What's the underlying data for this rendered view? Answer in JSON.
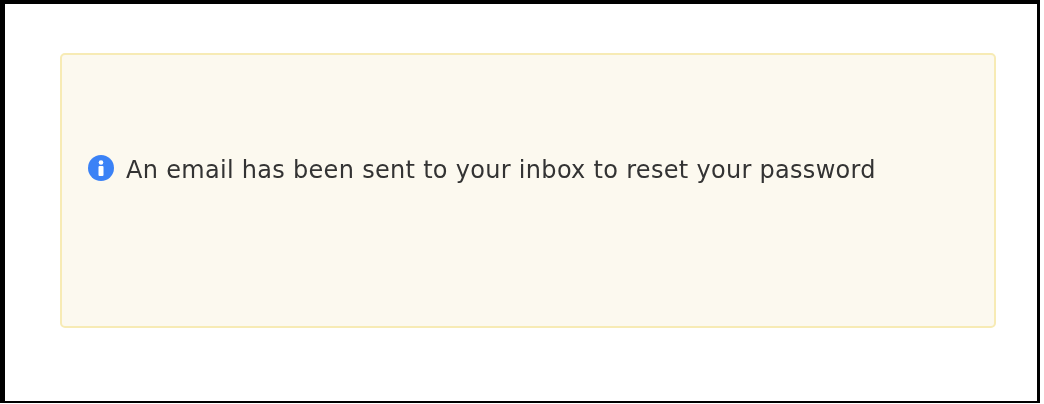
{
  "alert": {
    "kind": "info",
    "message": "An email has been sent to your inbox to reset your password"
  }
}
